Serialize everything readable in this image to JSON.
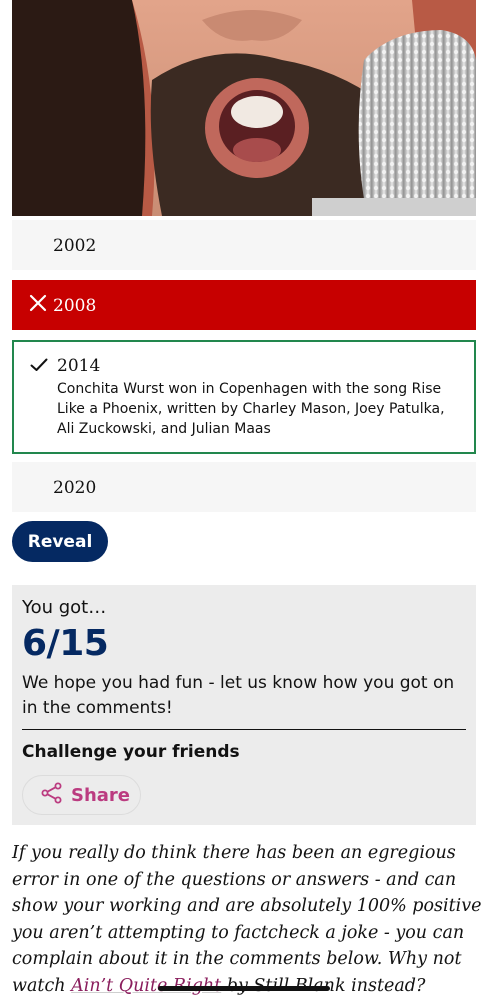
{
  "quiz": {
    "answers": [
      {
        "year": "2002",
        "state": "neutral"
      },
      {
        "year": "2008",
        "state": "wrong"
      },
      {
        "year": "2014",
        "state": "correct",
        "explanation": "Conchita Wurst won in Copenhagen with the song Rise Like a Phoenix, written by Charley Mason, Joey Patulka, Ali Zuckowski, and Julian Maas"
      },
      {
        "year": "2020",
        "state": "neutral"
      }
    ],
    "reveal_label": "Reveal"
  },
  "result": {
    "you_got": "You got…",
    "score": "6/15",
    "message": "We hope you had fun - let us know how you got on in the comments!",
    "challenge": "Challenge your friends",
    "share_label": "Share"
  },
  "footnote": {
    "text_before": "If you really do think there has been an egregious error in one of the questions or answers - and can show your working and are absolutely 100% positive you aren’t attempting to factcheck a joke - you can complain about it in the comments below. Why not watch ",
    "link_text": "Ain’t Quite Right",
    "text_after": " by Still Blank instead?"
  },
  "colors": {
    "wrong": "#c70000",
    "correct_border": "#22874d",
    "reveal_bg": "#052962",
    "score": "#052962",
    "share": "#bb3b80"
  },
  "icons": {
    "wrong": "close-icon",
    "correct": "check-icon",
    "share": "share-icon"
  }
}
